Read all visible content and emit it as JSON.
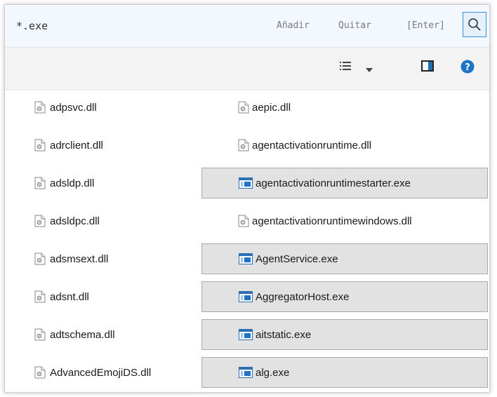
{
  "search": {
    "value": "*.exe",
    "add_label": "Añadir",
    "remove_label": "Quitar",
    "enter_label": "[Enter]"
  },
  "files_col1": [
    {
      "name": "adpsvc.dll"
    },
    {
      "name": "adrclient.dll"
    },
    {
      "name": "adsldp.dll"
    },
    {
      "name": "adsldpc.dll"
    },
    {
      "name": "adsmsext.dll"
    },
    {
      "name": "adsnt.dll"
    },
    {
      "name": "adtschema.dll"
    },
    {
      "name": "AdvancedEmojiDS.dll"
    }
  ],
  "files_col2": [
    {
      "name": "aepic.dll",
      "type": "dll",
      "selected": false
    },
    {
      "name": "agentactivationruntime.dll",
      "type": "dll",
      "selected": false
    },
    {
      "name": "agentactivationruntimestarter.exe",
      "type": "exe",
      "selected": true
    },
    {
      "name": "agentactivationruntimewindows.dll",
      "type": "dll",
      "selected": false
    },
    {
      "name": "AgentService.exe",
      "type": "exe",
      "selected": true
    },
    {
      "name": "AggregatorHost.exe",
      "type": "exe",
      "selected": true
    },
    {
      "name": "aitstatic.exe",
      "type": "exe",
      "selected": true
    },
    {
      "name": "alg.exe",
      "type": "exe",
      "selected": true
    }
  ],
  "colors": {
    "accent": "#1e73c8",
    "selection_fill": "#e2e2e2",
    "selection_border": "#a9a9a9",
    "search_bg": "#f2f8fd"
  },
  "icons": {
    "search": "magnifier-icon",
    "view": "details-view-icon",
    "preview": "preview-pane-icon",
    "help": "help-icon",
    "dll": "dll-file-icon",
    "exe": "exe-file-icon"
  }
}
